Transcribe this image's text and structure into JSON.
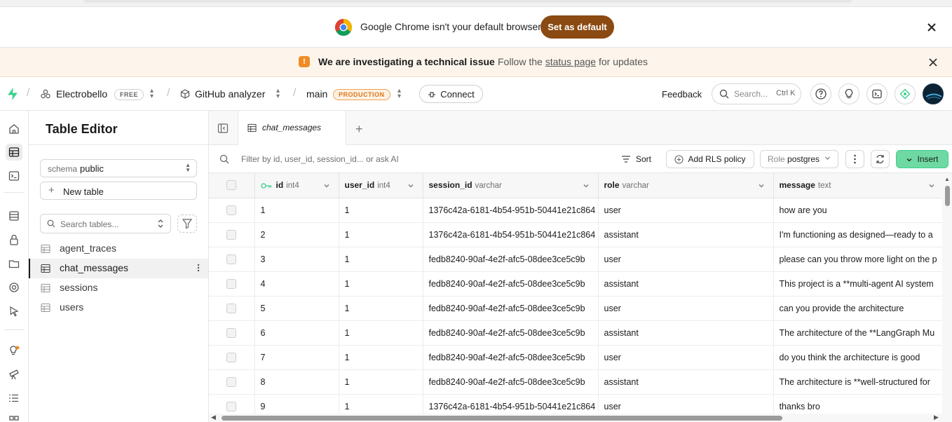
{
  "chrome_banner": {
    "message": "Google Chrome isn't your default browser",
    "button": "Set as default"
  },
  "status_banner": {
    "title": "We are investigating a technical issue",
    "separator": "·",
    "text_before": "Follow the ",
    "link": "status page",
    "text_after": " for updates"
  },
  "header": {
    "org": "Electrobello",
    "org_badge": "FREE",
    "project": "GitHub analyzer",
    "branch": "main",
    "branch_badge": "PRODUCTION",
    "connect": "Connect",
    "feedback": "Feedback",
    "search_placeholder": "Search...",
    "search_shortcut": "Ctrl K"
  },
  "sidebar": {
    "title": "Table Editor",
    "schema_label": "schema",
    "schema_value": "public",
    "new_table": "New table",
    "search_placeholder": "Search tables...",
    "tables": [
      "agent_traces",
      "chat_messages",
      "sessions",
      "users"
    ],
    "active_table": "chat_messages"
  },
  "tabs": {
    "active": "chat_messages"
  },
  "toolbar": {
    "filter_placeholder": "Filter by id, user_id, session_id... or ask AI",
    "sort": "Sort",
    "rls": "Add RLS policy",
    "role_label": "Role",
    "role_value": "postgres",
    "insert": "Insert"
  },
  "grid": {
    "columns": [
      {
        "name": "id",
        "type": "int4"
      },
      {
        "name": "user_id",
        "type": "int4"
      },
      {
        "name": "session_id",
        "type": "varchar"
      },
      {
        "name": "role",
        "type": "varchar"
      },
      {
        "name": "message",
        "type": "text"
      }
    ],
    "rows": [
      [
        "1",
        "1",
        "1376c42a-6181-4b54-951b-50441e21c864",
        "user",
        "how are you"
      ],
      [
        "2",
        "1",
        "1376c42a-6181-4b54-951b-50441e21c864",
        "assistant",
        "I'm functioning as designed—ready to a"
      ],
      [
        "3",
        "1",
        "fedb8240-90af-4e2f-afc5-08dee3ce5c9b",
        "user",
        "please can you throw more light on the p"
      ],
      [
        "4",
        "1",
        "fedb8240-90af-4e2f-afc5-08dee3ce5c9b",
        "assistant",
        "This project is a **multi-agent AI system"
      ],
      [
        "5",
        "1",
        "fedb8240-90af-4e2f-afc5-08dee3ce5c9b",
        "user",
        "can you provide the architecture"
      ],
      [
        "6",
        "1",
        "fedb8240-90af-4e2f-afc5-08dee3ce5c9b",
        "assistant",
        "The architecture of the **LangGraph Mu"
      ],
      [
        "7",
        "1",
        "fedb8240-90af-4e2f-afc5-08dee3ce5c9b",
        "user",
        "do you think the architecture is good"
      ],
      [
        "8",
        "1",
        "fedb8240-90af-4e2f-afc5-08dee3ce5c9b",
        "assistant",
        "The architecture is **well-structured for"
      ],
      [
        "9",
        "1",
        "1376c42a-6181-4b54-951b-50441e21c864",
        "user",
        "thanks bro"
      ]
    ]
  },
  "colors": {
    "brand": "#3ecf8e",
    "insert_bg": "#6fd9a3",
    "chrome_button": "#8a4a12",
    "status_icon": "#f08b24",
    "production": "#d9771b"
  }
}
